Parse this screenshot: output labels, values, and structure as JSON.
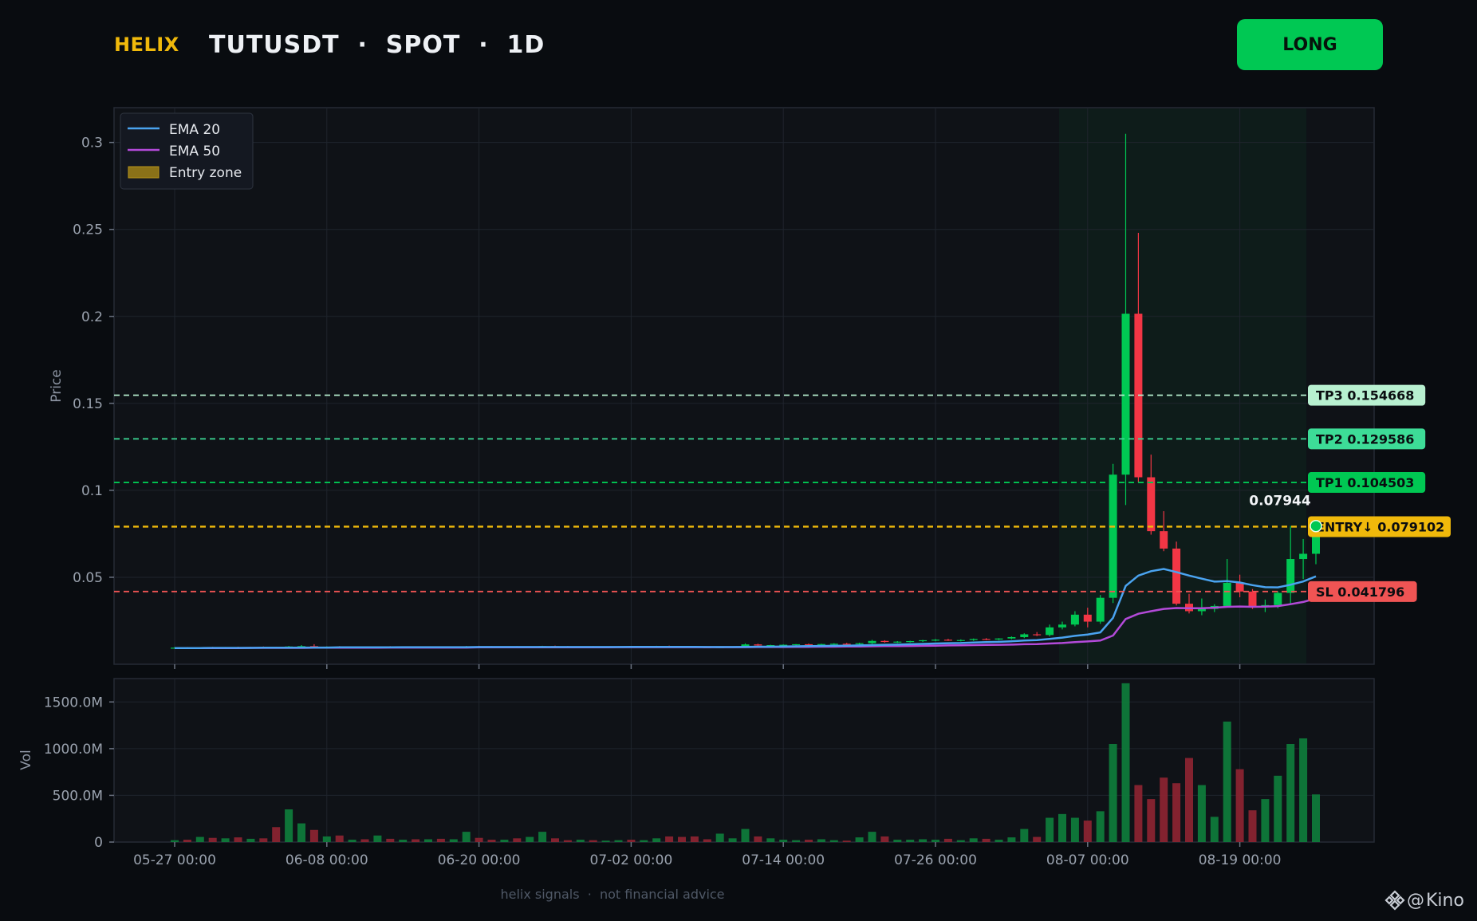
{
  "header": {
    "brand": "HELIX",
    "title": "TUTUSDT  ·  SPOT  ·  1D",
    "side_button": "LONG"
  },
  "footer": "helix signals  ·  not financial advice",
  "watermark": {
    "text": "Kino",
    "icon": "at-sign-icon",
    "logo": "exchange-diamond-logo"
  },
  "colors": {
    "background": "#090c10",
    "panel": "#0f1217",
    "up": "#00c853",
    "down": "#f23645",
    "ema20": "#4aa3f0",
    "ema50": "#b34ad9",
    "entry": "#f0b90b",
    "sl": "#f05454",
    "tp1": "#00c853",
    "tp2": "#3ddc97",
    "tp3": "#b8f0d0"
  },
  "chart_data": {
    "type": "candlestick",
    "timeframe": "1D",
    "x_ticks": [
      "05-27 00:00",
      "06-08 00:00",
      "06-20 00:00",
      "07-02 00:00",
      "07-14 00:00",
      "07-26 00:00",
      "08-07 00:00",
      "08-19 00:00"
    ],
    "price_axis": {
      "label": "Price",
      "ylim": [
        0,
        0.32
      ],
      "ticks": [
        0.05,
        0.1,
        0.15,
        0.2,
        0.25,
        0.3
      ],
      "tick_labels": [
        "0.05",
        "0.1",
        "0.15",
        "0.2",
        "0.25",
        "0.3"
      ]
    },
    "volume_axis": {
      "label": "Vol",
      "ylim": [
        0,
        1750
      ],
      "unit": "M",
      "ticks": [
        0,
        500,
        1000,
        1500
      ],
      "tick_labels": [
        "0",
        "500.0M",
        "1000.0M",
        "1500.0M"
      ]
    },
    "legend": {
      "placement": "top-left",
      "entries": [
        "EMA 20",
        "EMA 50",
        "Entry zone"
      ]
    },
    "levels": [
      {
        "key": "tp3",
        "label": "TP3 0.154668",
        "value": 0.154668
      },
      {
        "key": "tp2",
        "label": "TP2 0.129586",
        "value": 0.129586
      },
      {
        "key": "tp1",
        "label": "TP1 0.104503",
        "value": 0.104503
      },
      {
        "key": "entry",
        "label": "ENTRY↓ 0.079102",
        "value": 0.079102
      },
      {
        "key": "sl",
        "label": "SL 0.041796",
        "value": 0.041796
      }
    ],
    "last_price": {
      "label": "0.07944",
      "value": 0.07944
    },
    "entry_zone": {
      "from_index": 70,
      "to_index": 89
    },
    "candles": [
      {
        "o": 0.0093,
        "h": 0.0098,
        "l": 0.0091,
        "c": 0.0095,
        "v": 20
      },
      {
        "o": 0.0095,
        "h": 0.0099,
        "l": 0.0092,
        "c": 0.0094,
        "v": 25
      },
      {
        "o": 0.0094,
        "h": 0.0098,
        "l": 0.0091,
        "c": 0.0096,
        "v": 55
      },
      {
        "o": 0.0096,
        "h": 0.01,
        "l": 0.0093,
        "c": 0.0095,
        "v": 45
      },
      {
        "o": 0.0095,
        "h": 0.0099,
        "l": 0.0092,
        "c": 0.0097,
        "v": 40
      },
      {
        "o": 0.0097,
        "h": 0.0101,
        "l": 0.0094,
        "c": 0.0096,
        "v": 50
      },
      {
        "o": 0.0096,
        "h": 0.01,
        "l": 0.0093,
        "c": 0.0098,
        "v": 35
      },
      {
        "o": 0.0098,
        "h": 0.0102,
        "l": 0.0095,
        "c": 0.0097,
        "v": 40
      },
      {
        "o": 0.0097,
        "h": 0.0101,
        "l": 0.0094,
        "c": 0.0096,
        "v": 160
      },
      {
        "o": 0.0096,
        "h": 0.0105,
        "l": 0.0094,
        "c": 0.0102,
        "v": 350
      },
      {
        "o": 0.0102,
        "h": 0.011,
        "l": 0.0098,
        "c": 0.0104,
        "v": 200
      },
      {
        "o": 0.0104,
        "h": 0.0115,
        "l": 0.0096,
        "c": 0.0099,
        "v": 130
      },
      {
        "o": 0.0099,
        "h": 0.0103,
        "l": 0.0095,
        "c": 0.0101,
        "v": 60
      },
      {
        "o": 0.0101,
        "h": 0.0104,
        "l": 0.0096,
        "c": 0.0098,
        "v": 70
      },
      {
        "o": 0.0098,
        "h": 0.0102,
        "l": 0.0095,
        "c": 0.01,
        "v": 25
      },
      {
        "o": 0.01,
        "h": 0.0103,
        "l": 0.0096,
        "c": 0.0099,
        "v": 30
      },
      {
        "o": 0.0099,
        "h": 0.0103,
        "l": 0.0096,
        "c": 0.0101,
        "v": 70
      },
      {
        "o": 0.0101,
        "h": 0.0104,
        "l": 0.0097,
        "c": 0.0099,
        "v": 35
      },
      {
        "o": 0.0099,
        "h": 0.0102,
        "l": 0.0096,
        "c": 0.01,
        "v": 25
      },
      {
        "o": 0.01,
        "h": 0.0103,
        "l": 0.0097,
        "c": 0.0098,
        "v": 30
      },
      {
        "o": 0.0098,
        "h": 0.0102,
        "l": 0.0095,
        "c": 0.01,
        "v": 30
      },
      {
        "o": 0.01,
        "h": 0.0103,
        "l": 0.0097,
        "c": 0.0099,
        "v": 35
      },
      {
        "o": 0.0099,
        "h": 0.0102,
        "l": 0.0096,
        "c": 0.0101,
        "v": 30
      },
      {
        "o": 0.0101,
        "h": 0.0105,
        "l": 0.0098,
        "c": 0.0103,
        "v": 110
      },
      {
        "o": 0.0103,
        "h": 0.0106,
        "l": 0.0099,
        "c": 0.0101,
        "v": 45
      },
      {
        "o": 0.0101,
        "h": 0.0104,
        "l": 0.0098,
        "c": 0.0099,
        "v": 25
      },
      {
        "o": 0.0099,
        "h": 0.0102,
        "l": 0.0096,
        "c": 0.0101,
        "v": 25
      },
      {
        "o": 0.0101,
        "h": 0.0104,
        "l": 0.0098,
        "c": 0.01,
        "v": 40
      },
      {
        "o": 0.01,
        "h": 0.0103,
        "l": 0.0097,
        "c": 0.0102,
        "v": 55
      },
      {
        "o": 0.0102,
        "h": 0.0106,
        "l": 0.0099,
        "c": 0.0104,
        "v": 110
      },
      {
        "o": 0.0104,
        "h": 0.0107,
        "l": 0.01,
        "c": 0.0102,
        "v": 40
      },
      {
        "o": 0.0102,
        "h": 0.0105,
        "l": 0.0099,
        "c": 0.01,
        "v": 20
      },
      {
        "o": 0.01,
        "h": 0.0103,
        "l": 0.0097,
        "c": 0.0101,
        "v": 25
      },
      {
        "o": 0.0101,
        "h": 0.0104,
        "l": 0.0098,
        "c": 0.01,
        "v": 20
      },
      {
        "o": 0.01,
        "h": 0.0103,
        "l": 0.0097,
        "c": 0.0101,
        "v": 15
      },
      {
        "o": 0.0101,
        "h": 0.0104,
        "l": 0.0098,
        "c": 0.0102,
        "v": 20
      },
      {
        "o": 0.0102,
        "h": 0.0105,
        "l": 0.0099,
        "c": 0.0101,
        "v": 25
      },
      {
        "o": 0.0101,
        "h": 0.0104,
        "l": 0.0098,
        "c": 0.0102,
        "v": 20
      },
      {
        "o": 0.0102,
        "h": 0.0106,
        "l": 0.0099,
        "c": 0.0104,
        "v": 40
      },
      {
        "o": 0.0104,
        "h": 0.0107,
        "l": 0.01,
        "c": 0.0102,
        "v": 60
      },
      {
        "o": 0.0102,
        "h": 0.0105,
        "l": 0.0099,
        "c": 0.01,
        "v": 55
      },
      {
        "o": 0.01,
        "h": 0.0103,
        "l": 0.0097,
        "c": 0.0098,
        "v": 60
      },
      {
        "o": 0.0098,
        "h": 0.0101,
        "l": 0.0095,
        "c": 0.0096,
        "v": 30
      },
      {
        "o": 0.0096,
        "h": 0.01,
        "l": 0.0093,
        "c": 0.0098,
        "v": 90
      },
      {
        "o": 0.0098,
        "h": 0.0102,
        "l": 0.0095,
        "c": 0.0101,
        "v": 40
      },
      {
        "o": 0.0101,
        "h": 0.012,
        "l": 0.0098,
        "c": 0.0114,
        "v": 140
      },
      {
        "o": 0.0114,
        "h": 0.0118,
        "l": 0.0104,
        "c": 0.0108,
        "v": 60
      },
      {
        "o": 0.0108,
        "h": 0.0112,
        "l": 0.0102,
        "c": 0.011,
        "v": 40
      },
      {
        "o": 0.011,
        "h": 0.0114,
        "l": 0.0104,
        "c": 0.0112,
        "v": 25
      },
      {
        "o": 0.0112,
        "h": 0.0116,
        "l": 0.0106,
        "c": 0.0115,
        "v": 20
      },
      {
        "o": 0.0115,
        "h": 0.0119,
        "l": 0.0109,
        "c": 0.0113,
        "v": 25
      },
      {
        "o": 0.0113,
        "h": 0.0118,
        "l": 0.0108,
        "c": 0.0116,
        "v": 30
      },
      {
        "o": 0.0116,
        "h": 0.0121,
        "l": 0.011,
        "c": 0.0118,
        "v": 20
      },
      {
        "o": 0.0118,
        "h": 0.0123,
        "l": 0.0112,
        "c": 0.0117,
        "v": 15
      },
      {
        "o": 0.0117,
        "h": 0.0124,
        "l": 0.0112,
        "c": 0.0121,
        "v": 50
      },
      {
        "o": 0.0121,
        "h": 0.014,
        "l": 0.0116,
        "c": 0.0134,
        "v": 110
      },
      {
        "o": 0.0134,
        "h": 0.0138,
        "l": 0.0124,
        "c": 0.0128,
        "v": 60
      },
      {
        "o": 0.0128,
        "h": 0.0133,
        "l": 0.0122,
        "c": 0.013,
        "v": 25
      },
      {
        "o": 0.013,
        "h": 0.0135,
        "l": 0.0125,
        "c": 0.0133,
        "v": 25
      },
      {
        "o": 0.0133,
        "h": 0.014,
        "l": 0.0128,
        "c": 0.0138,
        "v": 30
      },
      {
        "o": 0.0138,
        "h": 0.0145,
        "l": 0.0132,
        "c": 0.0141,
        "v": 25
      },
      {
        "o": 0.0141,
        "h": 0.0146,
        "l": 0.0134,
        "c": 0.0137,
        "v": 35
      },
      {
        "o": 0.0137,
        "h": 0.0143,
        "l": 0.0131,
        "c": 0.0139,
        "v": 20
      },
      {
        "o": 0.0139,
        "h": 0.0148,
        "l": 0.0134,
        "c": 0.0145,
        "v": 40
      },
      {
        "o": 0.0145,
        "h": 0.015,
        "l": 0.0138,
        "c": 0.0142,
        "v": 35
      },
      {
        "o": 0.0142,
        "h": 0.015,
        "l": 0.0138,
        "c": 0.0148,
        "v": 25
      },
      {
        "o": 0.0148,
        "h": 0.016,
        "l": 0.0143,
        "c": 0.0156,
        "v": 50
      },
      {
        "o": 0.0156,
        "h": 0.0178,
        "l": 0.015,
        "c": 0.0172,
        "v": 140
      },
      {
        "o": 0.0172,
        "h": 0.0185,
        "l": 0.0162,
        "c": 0.0168,
        "v": 55
      },
      {
        "o": 0.0168,
        "h": 0.0228,
        "l": 0.016,
        "c": 0.0212,
        "v": 260
      },
      {
        "o": 0.0212,
        "h": 0.0245,
        "l": 0.02,
        "c": 0.0228,
        "v": 300
      },
      {
        "o": 0.0228,
        "h": 0.0305,
        "l": 0.0218,
        "c": 0.0285,
        "v": 260
      },
      {
        "o": 0.0285,
        "h": 0.0325,
        "l": 0.0212,
        "c": 0.0245,
        "v": 230
      },
      {
        "o": 0.0245,
        "h": 0.0398,
        "l": 0.0232,
        "c": 0.0382,
        "v": 330
      },
      {
        "o": 0.0382,
        "h": 0.1152,
        "l": 0.0352,
        "c": 0.109,
        "v": 1050
      },
      {
        "o": 0.109,
        "h": 0.305,
        "l": 0.0915,
        "c": 0.2015,
        "v": 1700
      },
      {
        "o": 0.2015,
        "h": 0.248,
        "l": 0.1045,
        "c": 0.1075,
        "v": 610
      },
      {
        "o": 0.1075,
        "h": 0.1205,
        "l": 0.0745,
        "c": 0.0765,
        "v": 460
      },
      {
        "o": 0.0765,
        "h": 0.088,
        "l": 0.065,
        "c": 0.0665,
        "v": 690
      },
      {
        "o": 0.0665,
        "h": 0.0705,
        "l": 0.0338,
        "c": 0.0348,
        "v": 630
      },
      {
        "o": 0.0348,
        "h": 0.0405,
        "l": 0.0292,
        "c": 0.0305,
        "v": 900
      },
      {
        "o": 0.0305,
        "h": 0.0378,
        "l": 0.0282,
        "c": 0.0318,
        "v": 610
      },
      {
        "o": 0.0318,
        "h": 0.0345,
        "l": 0.03,
        "c": 0.0335,
        "v": 270
      },
      {
        "o": 0.0335,
        "h": 0.0605,
        "l": 0.0328,
        "c": 0.0468,
        "v": 1290
      },
      {
        "o": 0.0468,
        "h": 0.0515,
        "l": 0.0385,
        "c": 0.0418,
        "v": 780
      },
      {
        "o": 0.0418,
        "h": 0.0432,
        "l": 0.0318,
        "c": 0.033,
        "v": 340
      },
      {
        "o": 0.033,
        "h": 0.0372,
        "l": 0.03,
        "c": 0.034,
        "v": 460
      },
      {
        "o": 0.034,
        "h": 0.042,
        "l": 0.0322,
        "c": 0.041,
        "v": 710
      },
      {
        "o": 0.041,
        "h": 0.0795,
        "l": 0.0345,
        "c": 0.0605,
        "v": 1050
      },
      {
        "o": 0.0605,
        "h": 0.072,
        "l": 0.049,
        "c": 0.0635,
        "v": 1110
      },
      {
        "o": 0.0635,
        "h": 0.081,
        "l": 0.0575,
        "c": 0.0794,
        "v": 510
      }
    ],
    "ema20": [
      0.0093,
      0.0093,
      0.0093,
      0.0094,
      0.0094,
      0.0094,
      0.0094,
      0.0095,
      0.0095,
      0.0095,
      0.0096,
      0.0096,
      0.0096,
      0.0097,
      0.0097,
      0.0097,
      0.0097,
      0.0097,
      0.0098,
      0.0098,
      0.0098,
      0.0098,
      0.0098,
      0.0098,
      0.0099,
      0.0099,
      0.0099,
      0.0099,
      0.0099,
      0.0099,
      0.0099,
      0.0099,
      0.0099,
      0.0099,
      0.0099,
      0.0099,
      0.01,
      0.01,
      0.01,
      0.01,
      0.01,
      0.01,
      0.0099,
      0.0099,
      0.0099,
      0.01,
      0.0101,
      0.0101,
      0.0102,
      0.0103,
      0.0104,
      0.0105,
      0.0106,
      0.0107,
      0.0108,
      0.011,
      0.0112,
      0.0113,
      0.0115,
      0.0117,
      0.0119,
      0.0121,
      0.0122,
      0.0125,
      0.0127,
      0.0129,
      0.0132,
      0.0136,
      0.0139,
      0.0146,
      0.0153,
      0.0163,
      0.0171,
      0.0183,
      0.0267,
      0.045,
      0.051,
      0.0535,
      0.0548,
      0.053,
      0.051,
      0.0492,
      0.0475,
      0.0478,
      0.047,
      0.0455,
      0.0443,
      0.0442,
      0.0457,
      0.0476,
      0.0505
    ],
    "ema50": [
      0.0093,
      0.0093,
      0.0093,
      0.0093,
      0.0093,
      0.0093,
      0.0094,
      0.0094,
      0.0094,
      0.0094,
      0.0094,
      0.0095,
      0.0095,
      0.0095,
      0.0095,
      0.0095,
      0.0095,
      0.0096,
      0.0096,
      0.0096,
      0.0096,
      0.0096,
      0.0096,
      0.0096,
      0.0097,
      0.0097,
      0.0097,
      0.0097,
      0.0097,
      0.0097,
      0.0097,
      0.0097,
      0.0097,
      0.0097,
      0.0097,
      0.0098,
      0.0098,
      0.0098,
      0.0098,
      0.0098,
      0.0098,
      0.0098,
      0.0098,
      0.0098,
      0.0098,
      0.0098,
      0.0099,
      0.0099,
      0.0099,
      0.01,
      0.01,
      0.0101,
      0.0101,
      0.0102,
      0.0102,
      0.0103,
      0.0104,
      0.0104,
      0.0105,
      0.0106,
      0.0107,
      0.0108,
      0.0109,
      0.011,
      0.0111,
      0.0112,
      0.0113,
      0.0115,
      0.0116,
      0.0119,
      0.0122,
      0.0127,
      0.0131,
      0.0136,
      0.0165,
      0.026,
      0.029,
      0.0305,
      0.0318,
      0.0323,
      0.0322,
      0.0322,
      0.0325,
      0.033,
      0.0332,
      0.033,
      0.0331,
      0.0334,
      0.0345,
      0.0358,
      0.0378
    ]
  }
}
